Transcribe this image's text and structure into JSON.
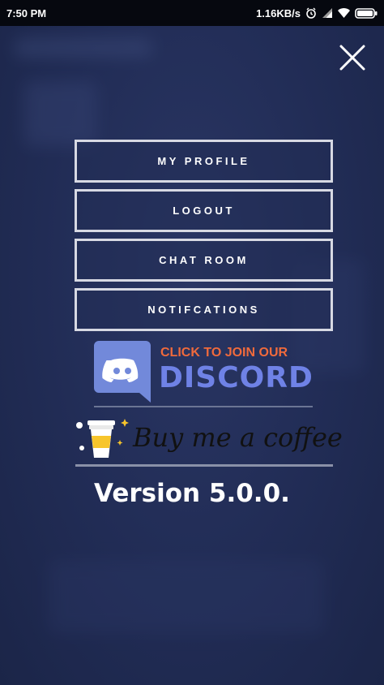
{
  "status_bar": {
    "time": "7:50 PM",
    "network_speed": "1.16KB/s",
    "icons": [
      "alarm-icon",
      "signal-icon",
      "wifi-icon",
      "battery-icon"
    ]
  },
  "close": {
    "icon": "close-icon"
  },
  "menu": {
    "items": [
      {
        "label": "MY PROFILE"
      },
      {
        "label": "LOGOUT"
      },
      {
        "label": "CHAT ROOM"
      },
      {
        "label": "NOTIFCATIONS"
      }
    ]
  },
  "discord": {
    "tagline": "CLICK TO JOIN OUR",
    "wordmark": "DISCORD",
    "icon": "discord-logo-icon"
  },
  "coffee": {
    "text": "Buy me a coffee",
    "icon": "coffee-cup-icon"
  },
  "version": "Version 5.0.0.",
  "colors": {
    "background": "#212c55",
    "status_bar": "#06080f",
    "button_border": "#d7d9e3",
    "discord_blurple": "#6f82e6",
    "discord_orange": "#f06a3c",
    "coffee_yellow": "#f7c52b"
  }
}
